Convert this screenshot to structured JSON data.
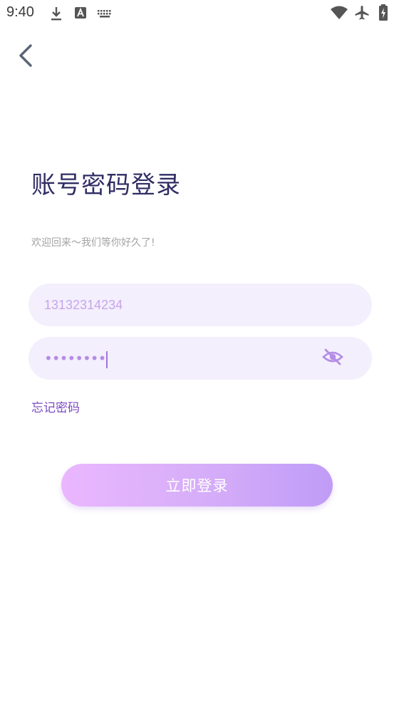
{
  "status_bar": {
    "time": "9:40",
    "icons": [
      "download-icon",
      "font-a-icon",
      "keyboard-icon",
      "wifi-icon",
      "airplane-icon",
      "battery-charging-icon"
    ]
  },
  "header": {
    "back_icon": "chevron-left-icon"
  },
  "main": {
    "title": "账号密码登录",
    "subtitle": "欢迎回来～我们等你好久了!",
    "phone_field": {
      "value": "13132314234",
      "placeholder": ""
    },
    "password_field": {
      "masked_value": "••••••••",
      "toggle_icon": "eye-off-icon"
    },
    "forgot_password": "忘记密码",
    "login_button": "立即登录"
  },
  "colors": {
    "title": "#2f2d63",
    "accent": "#7a4bc3",
    "field_bg": "#f3effc",
    "button_gradient_start": "#eab7fe",
    "button_gradient_end": "#c09cf7"
  }
}
